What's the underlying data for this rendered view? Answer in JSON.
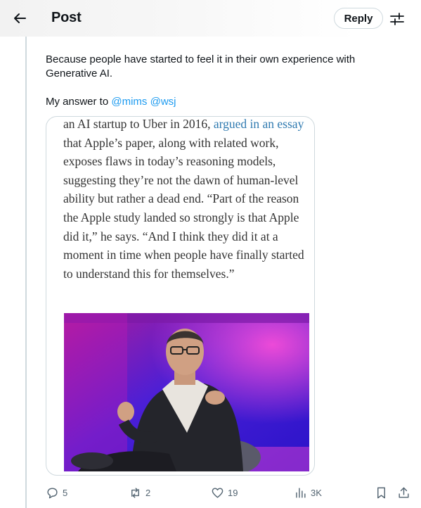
{
  "header": {
    "title": "Post",
    "reply_label": "Reply"
  },
  "post": {
    "text": "Because people have started to feel it in their own experience with Generative AI.",
    "answer_prefix": "My answer to",
    "mentions": [
      "@mims",
      "@wsj"
    ]
  },
  "quote": {
    "text_1": "an AI startup to Uber in 2016, ",
    "link_text": "argued in an essay",
    "text_2": " that Apple’s paper, along with related work, exposes flaws in today’s reasoning models, suggesting they’re not the dawn of human-level ability but rather a dead end. “Part of the reason the Apple study landed so strongly is that Apple did it,” he says. “And I think they did it at a moment in time when people have finally started to understand this for themselves.”"
  },
  "actions": {
    "replies": "5",
    "reposts": "2",
    "likes": "19",
    "views": "3K"
  },
  "colors": {
    "accent": "#1d9bf0",
    "muted": "#536471",
    "border": "#cfd9de"
  },
  "icons": [
    "back-arrow-icon",
    "tune-icon",
    "reply-icon",
    "repost-icon",
    "like-icon",
    "views-icon",
    "bookmark-icon",
    "share-icon"
  ]
}
